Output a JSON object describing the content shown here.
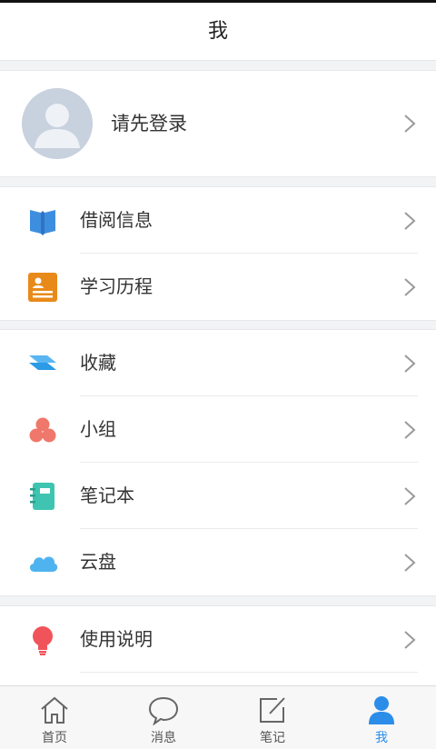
{
  "header": {
    "title": "我"
  },
  "profile": {
    "login_prompt": "请先登录"
  },
  "section1": [
    {
      "label": "借阅信息",
      "icon": "book-icon"
    },
    {
      "label": "学习历程",
      "icon": "study-record-icon"
    }
  ],
  "section2": [
    {
      "label": "收藏",
      "icon": "collection-icon"
    },
    {
      "label": "小组",
      "icon": "group-icon"
    },
    {
      "label": "笔记本",
      "icon": "notebook-icon"
    },
    {
      "label": "云盘",
      "icon": "cloud-icon"
    }
  ],
  "section3": [
    {
      "label": "使用说明",
      "icon": "lightbulb-icon"
    }
  ],
  "tabbar": {
    "items": [
      {
        "label": "首页",
        "icon": "home-icon"
      },
      {
        "label": "消息",
        "icon": "message-icon"
      },
      {
        "label": "笔记",
        "icon": "edit-note-icon"
      },
      {
        "label": "我",
        "icon": "user-icon"
      }
    ],
    "active_index": 3
  },
  "colors": {
    "accent": "#2b8de8",
    "book": "#3e8ee0",
    "study": "#e88a1a",
    "collection": "#2b9be6",
    "group": "#f0776b",
    "notebook": "#3fc4b1",
    "cloud": "#4fb3f0",
    "lightbulb": "#f0545a"
  }
}
